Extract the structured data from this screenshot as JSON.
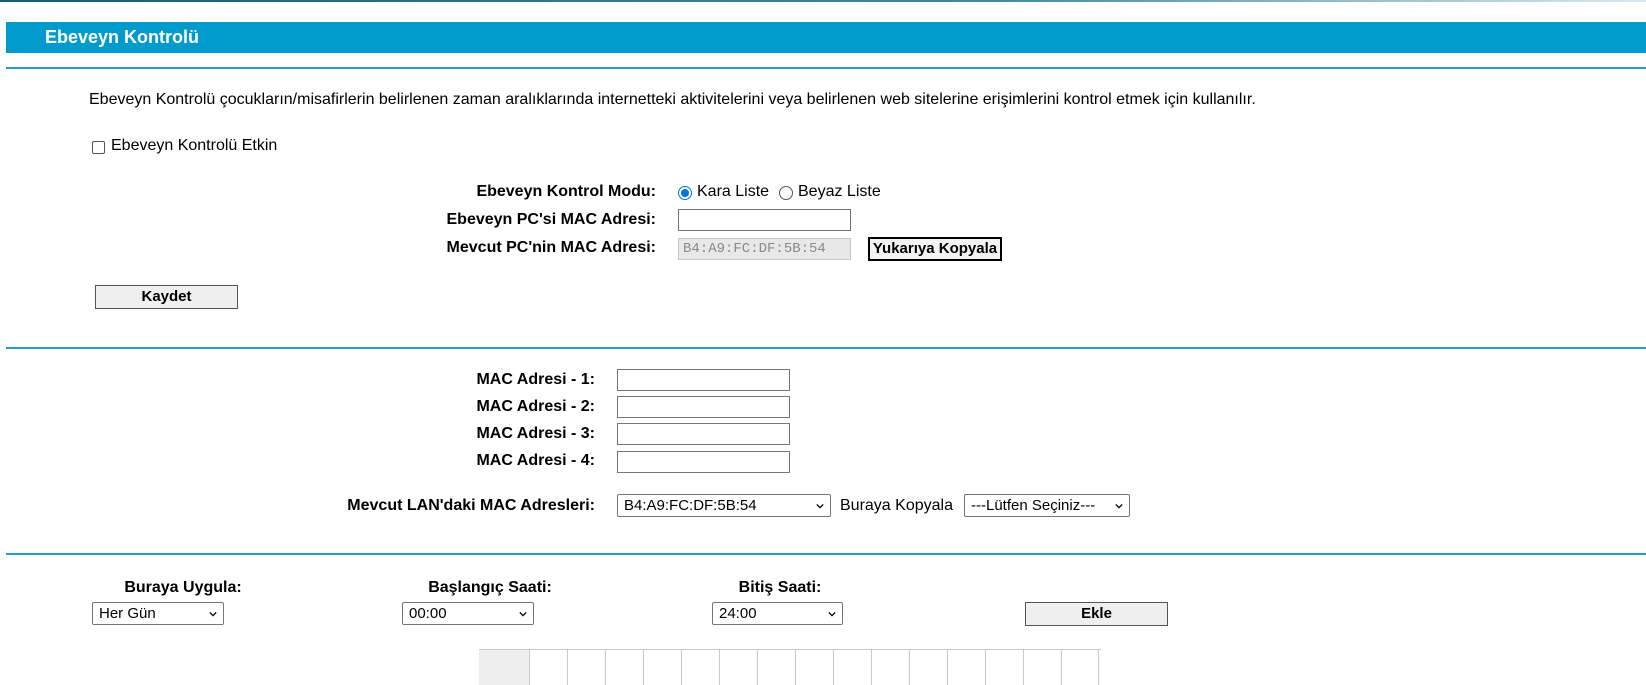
{
  "header": {
    "title": "Ebeveyn Kontrolü"
  },
  "intro": "Ebeveyn Kontrolü çocukların/misafirlerin belirlenen zaman aralıklarında internetteki aktivitelerini veya belirlenen web sitelerine erişimlerini kontrol etmek için kullanılır.",
  "enable": {
    "label": "Ebeveyn Kontrolü Etkin",
    "checked": false
  },
  "mode": {
    "label": "Ebeveyn Kontrol Modu:",
    "options": [
      {
        "label": "Kara Liste",
        "selected": true
      },
      {
        "label": "Beyaz Liste",
        "selected": false
      }
    ]
  },
  "parent_mac": {
    "label": "Ebeveyn PC'si MAC Adresi:",
    "value": ""
  },
  "current_mac": {
    "label": "Mevcut PC'nin MAC Adresi:",
    "value": "B4:A9:FC:DF:5B:54",
    "copy_label": "Yukarıya Kopyala"
  },
  "save_label": "Kaydet",
  "mac_list": [
    {
      "label": "MAC Adresi - 1:",
      "value": ""
    },
    {
      "label": "MAC Adresi - 2:",
      "value": ""
    },
    {
      "label": "MAC Adresi - 3:",
      "value": ""
    },
    {
      "label": "MAC Adresi - 4:",
      "value": ""
    }
  ],
  "lan": {
    "label": "Mevcut LAN'daki MAC Adresleri:",
    "selected": "B4:A9:FC:DF:5B:54",
    "copy_here_label": "Buraya Kopyala",
    "target_selected": "---Lütfen Seçiniz---"
  },
  "schedule": {
    "apply_label": "Buraya Uygula:",
    "apply_value": "Her Gün",
    "start_label": "Başlangıç Saati:",
    "start_value": "00:00",
    "end_label": "Bitiş Saati:",
    "end_value": "24:00",
    "add_label": "Ekle"
  },
  "colors": {
    "accent": "#009bcc",
    "rule": "#2a9ac5",
    "radio": "#0075d9"
  }
}
